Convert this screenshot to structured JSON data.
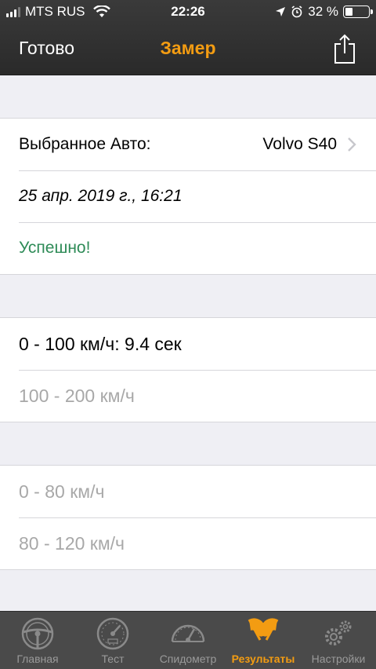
{
  "status_bar": {
    "carrier": "MTS RUS",
    "time": "22:26",
    "battery": "32 %",
    "battery_level": 0.32
  },
  "nav": {
    "left_label": "Готово",
    "title": "Замер",
    "right_icon": "share-icon"
  },
  "details": {
    "car_label": "Выбранное Авто:",
    "car_value": "Volvo S40",
    "date": "25 апр. 2019 г., 16:21",
    "status": "Успешно!"
  },
  "results": {
    "group1": [
      "0 - 100 км/ч: 9.4 сек",
      "100 - 200 км/ч"
    ],
    "group2": [
      "0 - 80 км/ч",
      "80 - 120 км/ч"
    ]
  },
  "tabbar": {
    "tabs": [
      {
        "label": "Главная",
        "icon": "steering-wheel-icon"
      },
      {
        "label": "Тест",
        "icon": "speedometer-dial-icon"
      },
      {
        "label": "Спидометр",
        "icon": "gauge-icon"
      },
      {
        "label": "Результаты",
        "icon": "racing-flags-icon",
        "active": true
      },
      {
        "label": "Настройки",
        "icon": "gears-icon"
      }
    ]
  },
  "colors": {
    "accent": "#f39c12",
    "success": "#2e8b57",
    "bar": "#2f2f2f",
    "tabbar": "#4a4a4a"
  }
}
